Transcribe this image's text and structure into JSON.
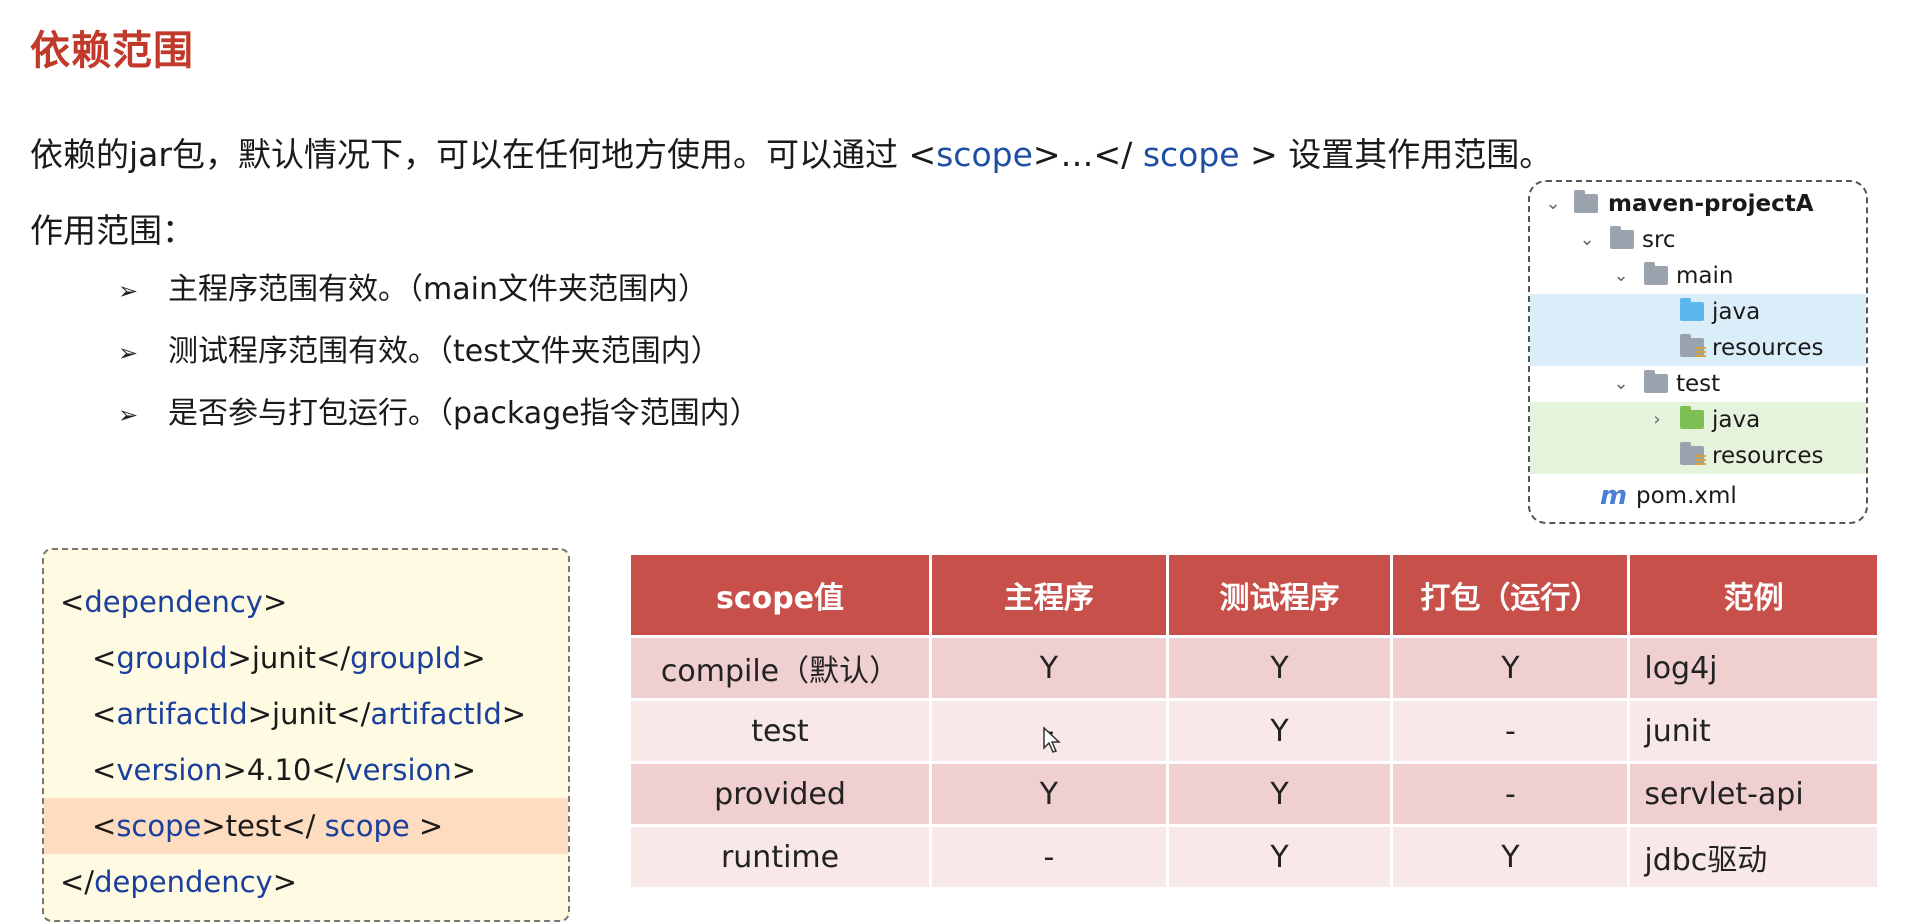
{
  "title": "依赖范围",
  "intro": {
    "prefix": "依赖的jar包，默认情况下，可以在任何地方使用。可以通过 <",
    "kw1": "scope",
    "middle": ">…</ ",
    "kw2": "scope",
    "suffix": " > 设置其作用范围。"
  },
  "scope_heading": "作用范围：",
  "bullets": [
    "主程序范围有效。（main文件夹范围内）",
    "测试程序范围有效。（test文件夹范围内）",
    "是否参与打包运行。（package指令范围内）"
  ],
  "tree": {
    "items": [
      {
        "label": "maven-projectA"
      },
      {
        "label": "src"
      },
      {
        "label": "main"
      },
      {
        "label": "java"
      },
      {
        "label": "resources"
      },
      {
        "label": "test"
      },
      {
        "label": "java"
      },
      {
        "label": "resources"
      },
      {
        "label": "pom.xml"
      }
    ],
    "pom_icon": "m"
  },
  "code": {
    "dependency": "dependency",
    "groupId_tag": "groupId",
    "groupId_value": "junit",
    "artifactId_tag": "artifactId",
    "artifactId_value": "junit",
    "version_tag": "version",
    "version_value": "4.10",
    "scope_tag": "scope",
    "scope_value": "test"
  },
  "table": {
    "headers": [
      "scope值",
      "主程序",
      "测试程序",
      "打包（运行）",
      "范例"
    ],
    "rows": [
      [
        "compile（默认）",
        "Y",
        "Y",
        "Y",
        "log4j"
      ],
      [
        "test",
        "-",
        "Y",
        "-",
        "junit"
      ],
      [
        "provided",
        "Y",
        "Y",
        "-",
        "servlet-api"
      ],
      [
        "runtime",
        "-",
        "Y",
        "Y",
        "jdbc驱动"
      ]
    ]
  },
  "colors": {
    "title": "#c0392b",
    "keyword": "#1f4fa3",
    "table_header": "#c8504a",
    "row_dark": "#efcfd0",
    "row_light": "#f8e8e8",
    "code_bg": "#fffbe3",
    "code_highlight": "#fddcbf"
  }
}
